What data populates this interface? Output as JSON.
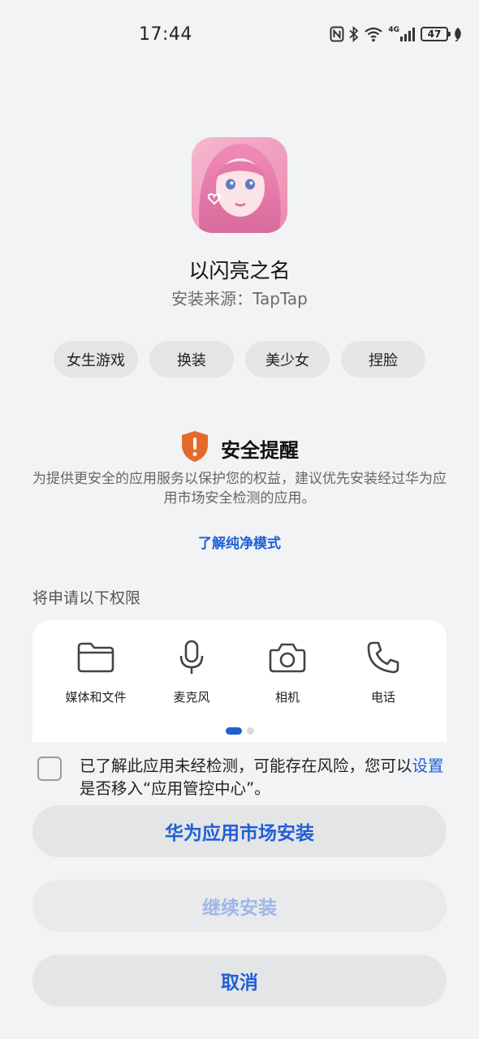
{
  "status_bar": {
    "time": "17:44",
    "battery": "47",
    "network": "4G"
  },
  "app": {
    "name": "以闪亮之名",
    "source": "安装来源：TapTap"
  },
  "tags": [
    "女生游戏",
    "换装",
    "美少女",
    "捏脸"
  ],
  "security": {
    "title": "安全提醒",
    "text": "为提供更安全的应用服务以保护您的权益，建议优先安装经过华为应用市场安全检测的应用。",
    "link": "了解纯净模式"
  },
  "permissions": {
    "heading": "将申请以下权限",
    "items": [
      {
        "label": "媒体和文件",
        "icon": "folder-icon"
      },
      {
        "label": "麦克风",
        "icon": "microphone-icon"
      },
      {
        "label": "相机",
        "icon": "camera-icon"
      },
      {
        "label": "电话",
        "icon": "phone-icon"
      }
    ]
  },
  "consent": {
    "before": "已了解此应用未经检测，可能存在风险，您可以",
    "link": "设置",
    "after": "是否移入“应用管控中心”。",
    "checked": false
  },
  "buttons": {
    "market_install": "华为应用市场安装",
    "continue_install": "继续安装",
    "cancel": "取消"
  },
  "colors": {
    "accent": "#1f5fd6",
    "warning": "#e46a2c",
    "background": "#f1f3f5"
  }
}
